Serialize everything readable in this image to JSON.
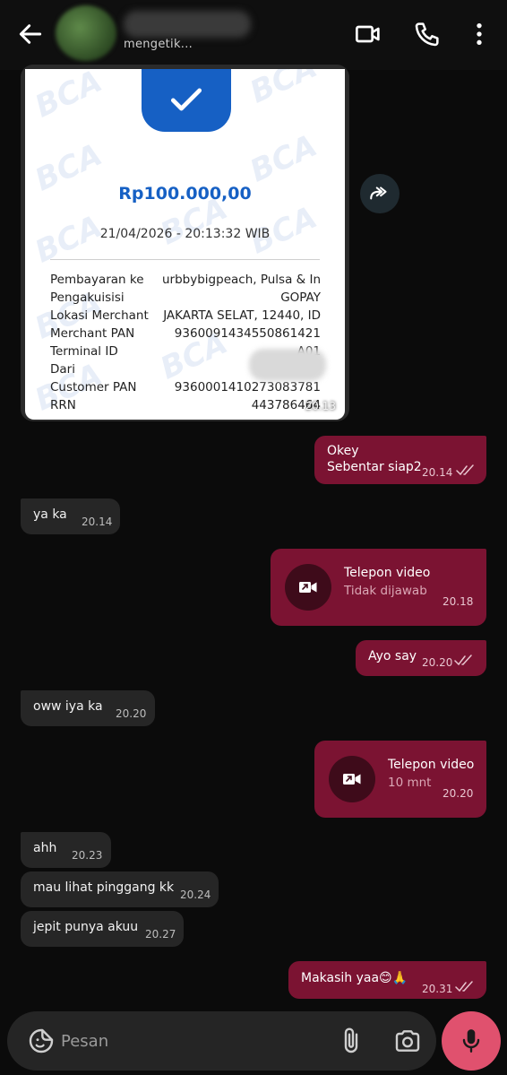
{
  "header": {
    "status": "mengetik...",
    "icons": [
      "back-arrow-icon",
      "video-call-icon",
      "phone-icon",
      "more-vert-icon"
    ]
  },
  "receipt": {
    "watermark": "BCA",
    "amount": "Rp100.000,00",
    "datetime": "21/04/2026 - 20:13:32 WIB",
    "rows": [
      {
        "label": "Pembayaran ke",
        "value": "urbbybigpeach, Pulsa & In"
      },
      {
        "label": "Pengakuisisi",
        "value": "GOPAY"
      },
      {
        "label": "Lokasi Merchant",
        "value": "JAKARTA SELAT, 12440, ID"
      },
      {
        "label": "Merchant PAN",
        "value": "9360091434550861421"
      },
      {
        "label": "Terminal ID",
        "value": "A01"
      },
      {
        "label": "Dari",
        "value": ""
      },
      {
        "label": "Customer PAN",
        "value": "9360001410273083781"
      },
      {
        "label": "RRN",
        "value": "443786464"
      }
    ],
    "time": "20.13"
  },
  "messages": {
    "m1": {
      "line1": "Okey",
      "line2": "Sebentar siap2",
      "time": "20.14"
    },
    "m2": {
      "text": "ya ka",
      "time": "20.14"
    },
    "m3": {
      "title": "Telepon video",
      "subtitle": "Tidak dijawab",
      "time": "20.18"
    },
    "m4": {
      "text": "Ayo say",
      "time": "20.20"
    },
    "m5": {
      "text": "oww iya ka",
      "time": "20.20"
    },
    "m6": {
      "title": "Telepon video",
      "subtitle": "10 mnt",
      "time": "20.20"
    },
    "m7": {
      "text": "ahh",
      "time": "20.23"
    },
    "m8": {
      "text": "mau lihat pinggang kk",
      "time": "20.24"
    },
    "m9": {
      "text": "jepit punya akuu",
      "time": "20.27"
    },
    "m10": {
      "text": "Makasih yaa😊🙏",
      "time": "20.31"
    }
  },
  "input": {
    "placeholder": "Pesan",
    "icons": [
      "emoji-sticker-icon",
      "attach-icon",
      "camera-icon",
      "mic-icon"
    ]
  },
  "colors": {
    "sent_bubble": "#7b1332",
    "recv_bubble": "#262626",
    "accent_mic": "#e0516e",
    "receipt_blue": "#1660c4"
  }
}
